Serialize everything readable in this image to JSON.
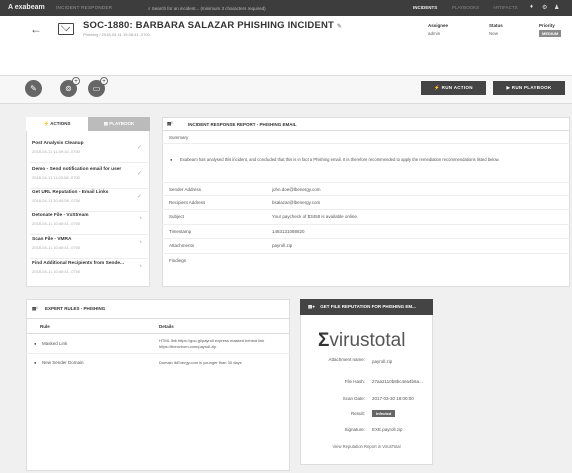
{
  "topbar": {
    "logo": "A exabeam",
    "product": "INCIDENT RESPONDER",
    "search_placeholder": "Search for an incident... (minimum 3 characters required)",
    "nav": [
      "INCIDENTS",
      "PLAYBOOKS",
      "ARTIFACTS"
    ],
    "icons": [
      "bell-icon",
      "gear-icon",
      "user-icon"
    ]
  },
  "incident": {
    "back_label": "←",
    "title": "SOC-1880: BARBARA SALAZAR PHISHING INCIDENT",
    "edit_mark": "✎",
    "subtitle": "Phishing / 2018-04-11 19:48:41 -0700",
    "assignee_label": "Assignee",
    "assignee_value": "admin",
    "status_label": "Status",
    "status_value": "New",
    "priority_label": "Priority",
    "priority_value": "MEDIUM"
  },
  "toolbar": {
    "run_action_label": "⚡ RUN ACTION",
    "run_playbook_label": "▶ RUN PLAYBOOK"
  },
  "left_panel": {
    "tabs": [
      "ACTIONS",
      "PLAYBOOK"
    ],
    "actions": [
      {
        "title": "Post Analysis Cleanup",
        "date": "2018-04-11 11:39:16 -0700",
        "status": "✓"
      },
      {
        "title": "Demo - Send notification email for user",
        "date": "2018-04-11 11:00:08 -0700",
        "status": "✓"
      },
      {
        "title": "Get URL Reputation - Email Links",
        "date": "2018-04-11 10:40:59 -0700",
        "status": "✓"
      },
      {
        "title": "Detonate File - VxStream",
        "date": "2018-04-11 10:40:41 -0700",
        "status": "◔"
      },
      {
        "title": "Scan File - VMRA",
        "date": "2018-04-11 10:40:41 -0700",
        "status": "◔"
      },
      {
        "title": "Find Additional Recipients from Sende...",
        "date": "2018-04-11 10:40:41 -0700",
        "status": "◔"
      }
    ]
  },
  "report": {
    "title": "INCIDENT RESPONSE REPORT - PHISHING EMAIL",
    "summary_label": "Summary",
    "summary_text": "Exabeam has analysed this incident, and concluded that this is in fact a Phishing email. It is therefore recommended to apply the remediation recommendations listed below.",
    "rows": [
      {
        "key": "Sender Address",
        "value": "john.doe@lbenergy.com"
      },
      {
        "key": "Recipient Address",
        "value": "bsalazar@lbenergy.com"
      },
      {
        "key": "Subject",
        "value": "Your paycheck of $3458 is available online."
      },
      {
        "key": "Timestamp",
        "value": "1483131088820"
      },
      {
        "key": "Attachments",
        "value": "payroll.zip"
      },
      {
        "key": "Findings",
        "value": ""
      }
    ]
  },
  "expert_rules": {
    "title": "EXPERT RULES - PHISHING",
    "col_rule": "Rule",
    "col_details": "Details",
    "rows": [
      {
        "rule": "Masked Link",
        "details": "HTML link https://goo.gl/payroll express masked behind link https://thenvirom.com/payroll.zip"
      },
      {
        "rule": "New Sender Domain",
        "details": "Domain lbEnergy.com is younger than 30 days"
      }
    ]
  },
  "virustotal": {
    "title": "GET FILE REPUTATION FOR PHISHING EM...",
    "logo_bold": "Σ",
    "logo_text": "virustotal",
    "rows": [
      {
        "key": "Attachment name:",
        "value": "payroll.zip"
      },
      {
        "key": "File Hash:",
        "value": "27aa2110b8bc4ea4b6a..."
      },
      {
        "key": "Scan Date:",
        "value": "2017-03-30 18:00:00"
      },
      {
        "key": "Result:",
        "value": "Infected"
      },
      {
        "key": "Signature:",
        "value": "EXE.payroll.zip"
      }
    ],
    "link": "View Reputation Report in VirusTotal"
  }
}
